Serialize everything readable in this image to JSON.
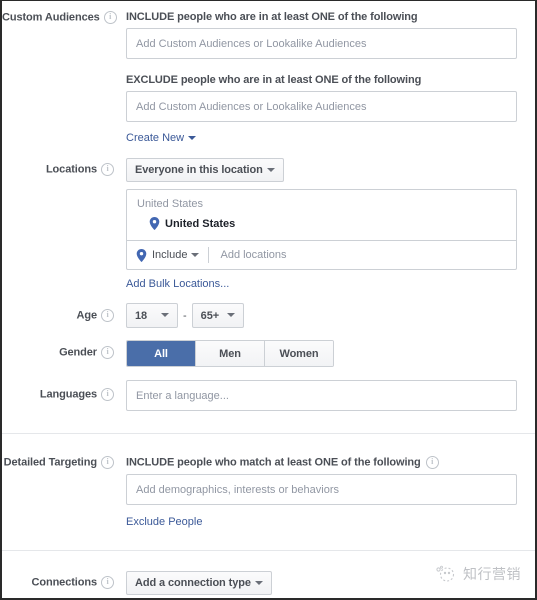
{
  "sections": {
    "custom_audiences": {
      "label": "Custom Audiences",
      "include_heading": "INCLUDE people who are in at least ONE of the following",
      "include_placeholder": "Add Custom Audiences or Lookalike Audiences",
      "include_value": "",
      "exclude_heading": "EXCLUDE people who are in at least ONE of the following",
      "exclude_placeholder": "Add Custom Audiences or Lookalike Audiences",
      "exclude_value": "",
      "create_new_link": "Create New"
    },
    "locations": {
      "label": "Locations",
      "scope_dropdown": "Everyone in this location",
      "group_title": "United States",
      "items": [
        {
          "name": "United States",
          "icon": "map-pin-icon"
        }
      ],
      "include_dropdown": "Include",
      "add_locations_placeholder": "Add locations",
      "add_locations_value": "",
      "bulk_link": "Add Bulk Locations..."
    },
    "age": {
      "label": "Age",
      "min": "18",
      "max": "65+",
      "separator": "-"
    },
    "gender": {
      "label": "Gender",
      "options": [
        "All",
        "Men",
        "Women"
      ],
      "selected": "All"
    },
    "languages": {
      "label": "Languages",
      "placeholder": "Enter a language...",
      "value": ""
    },
    "detailed_targeting": {
      "label": "Detailed Targeting",
      "include_heading": "INCLUDE people who match at least ONE of the following",
      "placeholder": "Add demographics, interests or behaviors",
      "value": "",
      "exclude_link": "Exclude People"
    },
    "connections": {
      "label": "Connections",
      "dropdown": "Add a connection type"
    }
  },
  "icons": {
    "info": "i",
    "info_name": "info-icon",
    "caret": "caret-down-icon",
    "pin": "map-pin-icon"
  },
  "watermark": {
    "text": "知行营销",
    "logo_name": "watermark-logo-icon"
  },
  "colors": {
    "accent_blue": "#4a6ea9",
    "link_blue": "#3b5998",
    "pin_blue": "#4267b2",
    "border": "#ccd0d5",
    "label_gray": "#4b4f56",
    "placeholder_gray": "#9197a3"
  }
}
